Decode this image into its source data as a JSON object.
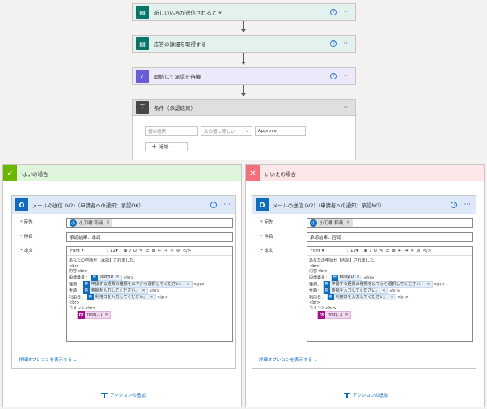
{
  "flow": {
    "steps": [
      {
        "title": "新しい応答が送信されるとき",
        "icon": "forms-icon",
        "color": "#077568",
        "bg": "#e3f2ef"
      },
      {
        "title": "応答の詳細を取得する",
        "icon": "forms-icon",
        "color": "#077568",
        "bg": "#e3f2ef"
      },
      {
        "title": "開始して承認を待機",
        "icon": "approvals-icon",
        "color": "#6a5bd6",
        "bg": "#ece9fb"
      }
    ],
    "condition": {
      "title": "条件（承認結果）",
      "left_placeholder": "値の選択",
      "operator": "次の値に等しい",
      "right_value": "Approve",
      "add_label": "追加"
    }
  },
  "branches": {
    "yes": {
      "header": "はいの場合",
      "header_bg": "#dff6dd",
      "marker_bg": "#6bb700",
      "card_title": "メールの送信 (V2)（申請者への通知：承認OK）",
      "to_label": "宛先",
      "to_value": "小刀禰 和哉",
      "subject_label": "件名",
      "subject_value": "承認結果：承認",
      "body_label": "本文",
      "font_name": "Font",
      "font_size": "12",
      "body_lines": {
        "l1": "あなたの申請が【承認】されました。",
        "br": "<br>",
        "naiyo": "内容<br>",
        "shinsei_no": "申請番号：",
        "token_id": "bodyID",
        "shubetsu": "種類：",
        "token_kind": "申請する経費の種類を以下から選択してください。",
        "kingaku": "金額：",
        "token_amount": "金額を入力してください。",
        "riyoubi": "利用日：",
        "token_date": "利用日を入力してください。",
        "comment": "コメント<br>",
        "token_fx": "first(...)"
      },
      "advanced_link": "詳細オプションを表示する",
      "add_action": "アクションの追加"
    },
    "no": {
      "header": "いいえの場合",
      "header_bg": "#fde7e9",
      "marker_bg": "#f1707b",
      "card_title": "メールの送信 (V2)（申請者への通知：承認NG）",
      "to_label": "宛先",
      "to_value": "小刀禰 和哉",
      "subject_label": "件名",
      "subject_value": "承認結果：否認",
      "body_label": "本文",
      "font_name": "Font",
      "font_size": "12",
      "body_lines": {
        "l1": "あなたの申請が【否認】されました。",
        "br": "<br>",
        "naiyo": "内容<br>",
        "shinsei_no": "申請番号：",
        "token_id": "bodyID",
        "shubetsu": "種類：",
        "token_kind": "申請する経費の種類を以下から選択してください。",
        "kingaku": "金額：",
        "token_amount": "金額を入力してください。",
        "riyoubi": "利用日：",
        "token_date": "利用日を入力してください。",
        "comment": "コメント<br>",
        "token_fx": "first(...)"
      },
      "advanced_link": "詳細オプションを表示する",
      "add_action": "アクションの追加"
    }
  },
  "accent": "#0f6cbd"
}
